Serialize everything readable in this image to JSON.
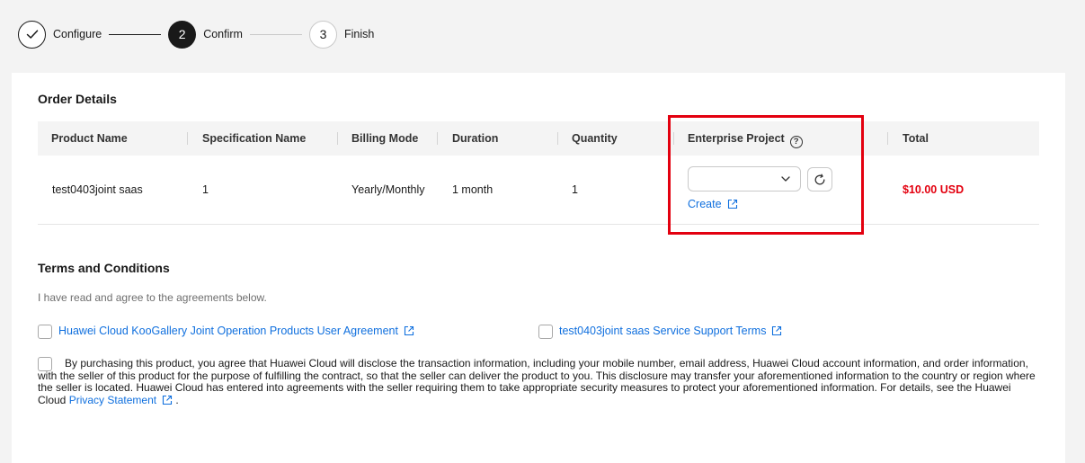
{
  "steps": [
    {
      "number": "",
      "label": "Configure",
      "state": "done"
    },
    {
      "number": "2",
      "label": "Confirm",
      "state": "active"
    },
    {
      "number": "3",
      "label": "Finish",
      "state": "todo"
    }
  ],
  "order": {
    "title": "Order Details",
    "columns": {
      "product_name": "Product Name",
      "specification_name": "Specification Name",
      "billing_mode": "Billing Mode",
      "duration": "Duration",
      "quantity": "Quantity",
      "enterprise_project": "Enterprise Project",
      "total": "Total"
    },
    "row": {
      "product_name": "test0403joint saas",
      "specification_name": "1",
      "billing_mode": "Yearly/Monthly",
      "duration": "1 month",
      "quantity": "1",
      "enterprise_project_value": "",
      "create_label": "Create",
      "total": "$10.00 USD"
    }
  },
  "terms": {
    "title": "Terms and Conditions",
    "intro": "I have read and agree to the agreements below.",
    "agreements": [
      {
        "label": "Huawei Cloud KooGallery Joint Operation Products User Agreement",
        "checked": false
      },
      {
        "label": "test0403joint saas Service Support Terms",
        "checked": false
      }
    ],
    "disclosure_text": "By purchasing this product, you agree that Huawei Cloud will disclose the transaction information, including your mobile number, email address, Huawei Cloud account information, and order information, with the seller of this product for the purpose of fulfilling the contract, so that the seller can deliver the product to you. This disclosure may transfer your aforementioned information to the country or region where the seller is located. Huawei Cloud has entered into agreements with the seller requiring them to take appropriate security measures to protect your aforementioned information. For details, see the Huawei Cloud",
    "privacy_link": "Privacy Statement",
    "period": ".",
    "disclosure_checked": false
  },
  "colors": {
    "accent": "#0f6fde",
    "price": "#e3000f",
    "highlight_box": "#e3000f",
    "text": "#191919"
  }
}
